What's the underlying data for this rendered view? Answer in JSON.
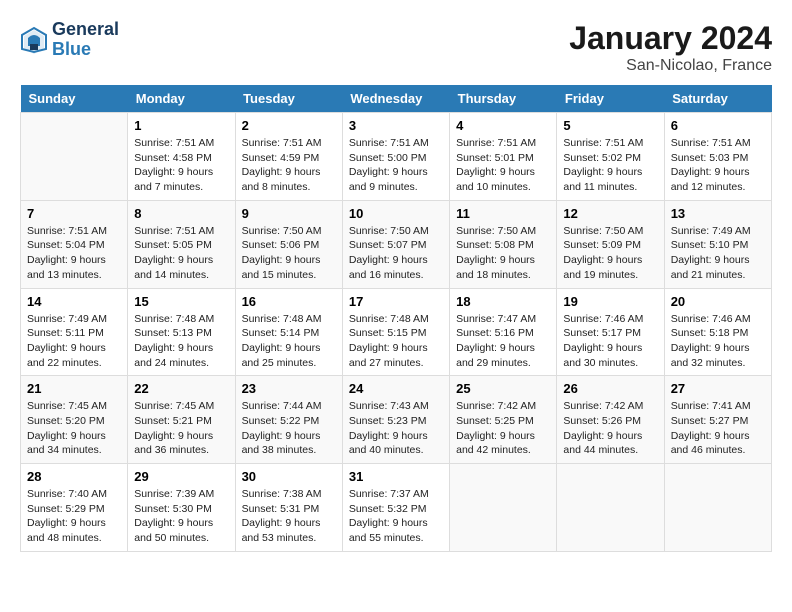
{
  "header": {
    "logo_line1": "General",
    "logo_line2": "Blue",
    "title": "January 2024",
    "subtitle": "San-Nicolao, France"
  },
  "columns": [
    "Sunday",
    "Monday",
    "Tuesday",
    "Wednesday",
    "Thursday",
    "Friday",
    "Saturday"
  ],
  "weeks": [
    [
      {
        "day": "",
        "content": ""
      },
      {
        "day": "1",
        "content": "Sunrise: 7:51 AM\nSunset: 4:58 PM\nDaylight: 9 hours\nand 7 minutes."
      },
      {
        "day": "2",
        "content": "Sunrise: 7:51 AM\nSunset: 4:59 PM\nDaylight: 9 hours\nand 8 minutes."
      },
      {
        "day": "3",
        "content": "Sunrise: 7:51 AM\nSunset: 5:00 PM\nDaylight: 9 hours\nand 9 minutes."
      },
      {
        "day": "4",
        "content": "Sunrise: 7:51 AM\nSunset: 5:01 PM\nDaylight: 9 hours\nand 10 minutes."
      },
      {
        "day": "5",
        "content": "Sunrise: 7:51 AM\nSunset: 5:02 PM\nDaylight: 9 hours\nand 11 minutes."
      },
      {
        "day": "6",
        "content": "Sunrise: 7:51 AM\nSunset: 5:03 PM\nDaylight: 9 hours\nand 12 minutes."
      }
    ],
    [
      {
        "day": "7",
        "content": "Sunrise: 7:51 AM\nSunset: 5:04 PM\nDaylight: 9 hours\nand 13 minutes."
      },
      {
        "day": "8",
        "content": "Sunrise: 7:51 AM\nSunset: 5:05 PM\nDaylight: 9 hours\nand 14 minutes."
      },
      {
        "day": "9",
        "content": "Sunrise: 7:50 AM\nSunset: 5:06 PM\nDaylight: 9 hours\nand 15 minutes."
      },
      {
        "day": "10",
        "content": "Sunrise: 7:50 AM\nSunset: 5:07 PM\nDaylight: 9 hours\nand 16 minutes."
      },
      {
        "day": "11",
        "content": "Sunrise: 7:50 AM\nSunset: 5:08 PM\nDaylight: 9 hours\nand 18 minutes."
      },
      {
        "day": "12",
        "content": "Sunrise: 7:50 AM\nSunset: 5:09 PM\nDaylight: 9 hours\nand 19 minutes."
      },
      {
        "day": "13",
        "content": "Sunrise: 7:49 AM\nSunset: 5:10 PM\nDaylight: 9 hours\nand 21 minutes."
      }
    ],
    [
      {
        "day": "14",
        "content": "Sunrise: 7:49 AM\nSunset: 5:11 PM\nDaylight: 9 hours\nand 22 minutes."
      },
      {
        "day": "15",
        "content": "Sunrise: 7:48 AM\nSunset: 5:13 PM\nDaylight: 9 hours\nand 24 minutes."
      },
      {
        "day": "16",
        "content": "Sunrise: 7:48 AM\nSunset: 5:14 PM\nDaylight: 9 hours\nand 25 minutes."
      },
      {
        "day": "17",
        "content": "Sunrise: 7:48 AM\nSunset: 5:15 PM\nDaylight: 9 hours\nand 27 minutes."
      },
      {
        "day": "18",
        "content": "Sunrise: 7:47 AM\nSunset: 5:16 PM\nDaylight: 9 hours\nand 29 minutes."
      },
      {
        "day": "19",
        "content": "Sunrise: 7:46 AM\nSunset: 5:17 PM\nDaylight: 9 hours\nand 30 minutes."
      },
      {
        "day": "20",
        "content": "Sunrise: 7:46 AM\nSunset: 5:18 PM\nDaylight: 9 hours\nand 32 minutes."
      }
    ],
    [
      {
        "day": "21",
        "content": "Sunrise: 7:45 AM\nSunset: 5:20 PM\nDaylight: 9 hours\nand 34 minutes."
      },
      {
        "day": "22",
        "content": "Sunrise: 7:45 AM\nSunset: 5:21 PM\nDaylight: 9 hours\nand 36 minutes."
      },
      {
        "day": "23",
        "content": "Sunrise: 7:44 AM\nSunset: 5:22 PM\nDaylight: 9 hours\nand 38 minutes."
      },
      {
        "day": "24",
        "content": "Sunrise: 7:43 AM\nSunset: 5:23 PM\nDaylight: 9 hours\nand 40 minutes."
      },
      {
        "day": "25",
        "content": "Sunrise: 7:42 AM\nSunset: 5:25 PM\nDaylight: 9 hours\nand 42 minutes."
      },
      {
        "day": "26",
        "content": "Sunrise: 7:42 AM\nSunset: 5:26 PM\nDaylight: 9 hours\nand 44 minutes."
      },
      {
        "day": "27",
        "content": "Sunrise: 7:41 AM\nSunset: 5:27 PM\nDaylight: 9 hours\nand 46 minutes."
      }
    ],
    [
      {
        "day": "28",
        "content": "Sunrise: 7:40 AM\nSunset: 5:29 PM\nDaylight: 9 hours\nand 48 minutes."
      },
      {
        "day": "29",
        "content": "Sunrise: 7:39 AM\nSunset: 5:30 PM\nDaylight: 9 hours\nand 50 minutes."
      },
      {
        "day": "30",
        "content": "Sunrise: 7:38 AM\nSunset: 5:31 PM\nDaylight: 9 hours\nand 53 minutes."
      },
      {
        "day": "31",
        "content": "Sunrise: 7:37 AM\nSunset: 5:32 PM\nDaylight: 9 hours\nand 55 minutes."
      },
      {
        "day": "",
        "content": ""
      },
      {
        "day": "",
        "content": ""
      },
      {
        "day": "",
        "content": ""
      }
    ]
  ]
}
